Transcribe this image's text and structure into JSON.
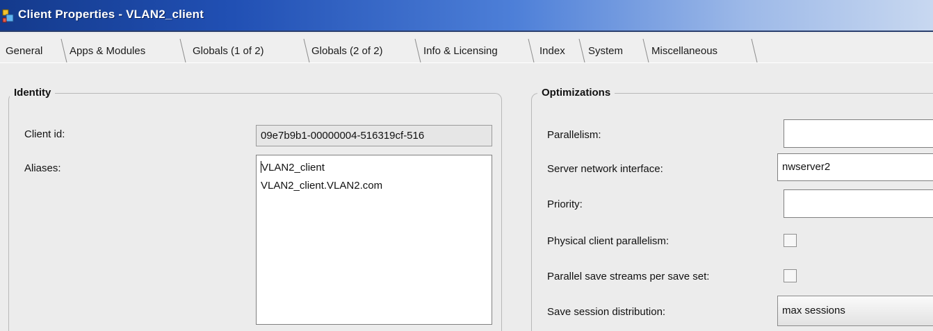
{
  "window": {
    "title": "Client Properties - VLAN2_client"
  },
  "tabs": [
    {
      "label": "General"
    },
    {
      "label": "Apps & Modules"
    },
    {
      "label": "Globals (1 of 2)",
      "selected": true
    },
    {
      "label": "Globals (2 of 2)"
    },
    {
      "label": "Info & Licensing"
    },
    {
      "label": "Index"
    },
    {
      "label": "System"
    },
    {
      "label": "Miscellaneous"
    }
  ],
  "identity": {
    "title": "Identity",
    "client_id_label": "Client id:",
    "client_id_value": "09e7b9b1-00000004-516319cf-516",
    "aliases_label": "Aliases:",
    "aliases": [
      "VLAN2_client",
      "VLAN2_client.VLAN2.com"
    ]
  },
  "optimizations": {
    "title": "Optimizations",
    "parallelism_label": "Parallelism:",
    "parallelism_value": "",
    "server_interface_label": "Server network interface:",
    "server_interface_value": "nwserver2",
    "priority_label": "Priority:",
    "priority_value": "",
    "physical_parallelism_label": "Physical client parallelism:",
    "physical_parallelism_checked": false,
    "parallel_streams_label": "Parallel save streams per save set:",
    "parallel_streams_checked": false,
    "save_session_label": "Save session distribution:",
    "save_session_value": "max sessions"
  },
  "icons": {
    "app": "client-properties-icon"
  },
  "colors": {
    "title_bar_start": "#143a8c",
    "title_bar_end": "#c8d8f0",
    "window_bg": "#ececec"
  }
}
